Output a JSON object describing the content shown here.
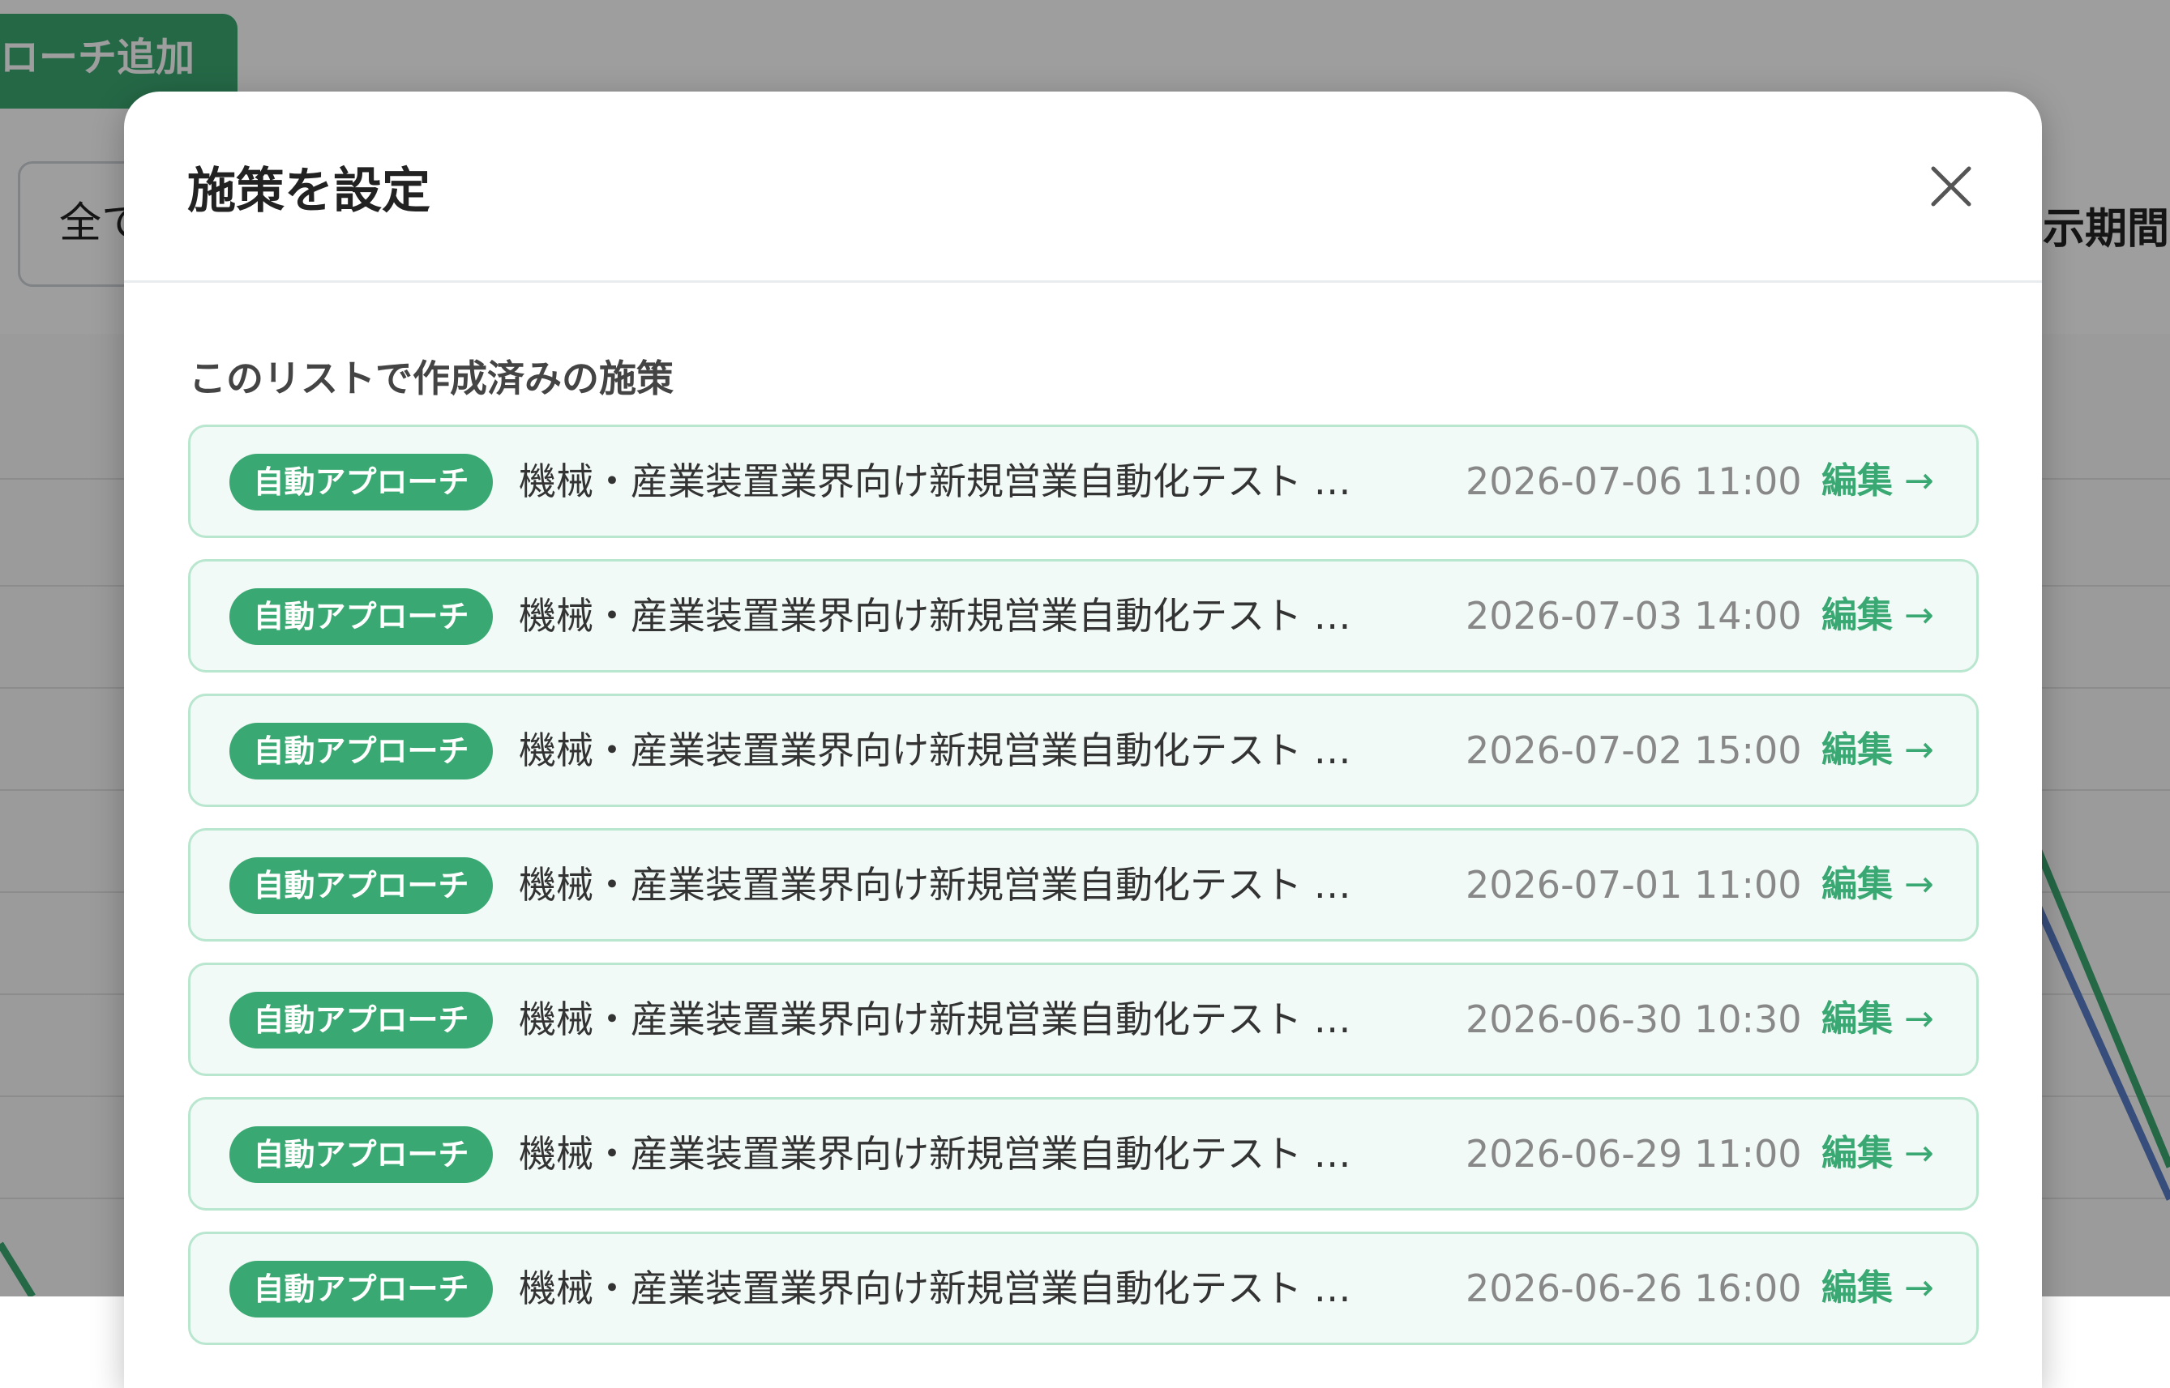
{
  "background": {
    "add_button_label": "ローチ追加",
    "filter_label": "全て",
    "period_label": "示期間"
  },
  "modal": {
    "title": "施策を設定",
    "close_icon": "close-icon",
    "section_title": "このリストで作成済みの施策",
    "items": [
      {
        "badge": "自動アプローチ",
        "title": "機械・産業装置業界向け新規営業自動化テスト 自…",
        "date": "2026-07-06 11:00",
        "edit_label": "編集",
        "arrow": "→"
      },
      {
        "badge": "自動アプローチ",
        "title": "機械・産業装置業界向け新規営業自動化テスト 自…",
        "date": "2026-07-03 14:00",
        "edit_label": "編集",
        "arrow": "→"
      },
      {
        "badge": "自動アプローチ",
        "title": "機械・産業装置業界向け新規営業自動化テスト 自…",
        "date": "2026-07-02 15:00",
        "edit_label": "編集",
        "arrow": "→"
      },
      {
        "badge": "自動アプローチ",
        "title": "機械・産業装置業界向け新規営業自動化テスト 自…",
        "date": "2026-07-01 11:00",
        "edit_label": "編集",
        "arrow": "→"
      },
      {
        "badge": "自動アプローチ",
        "title": "機械・産業装置業界向け新規営業自動化テスト 自…",
        "date": "2026-06-30 10:30",
        "edit_label": "編集",
        "arrow": "→"
      },
      {
        "badge": "自動アプローチ",
        "title": "機械・産業装置業界向け新規営業自動化テスト 自…",
        "date": "2026-06-29 11:00",
        "edit_label": "編集",
        "arrow": "→"
      },
      {
        "badge": "自動アプローチ",
        "title": "機械・産業装置業界向け新規営業自動化テスト 自…",
        "date": "2026-06-26 16:00",
        "edit_label": "編集",
        "arrow": "→"
      }
    ]
  },
  "colors": {
    "accent": "#3aa872",
    "item_bg": "#f1faf6",
    "item_border": "#b9e6cf",
    "overlay": "rgba(0,0,0,0.38)",
    "chart_green": "#3aa872",
    "chart_blue": "#5a7fc8"
  }
}
